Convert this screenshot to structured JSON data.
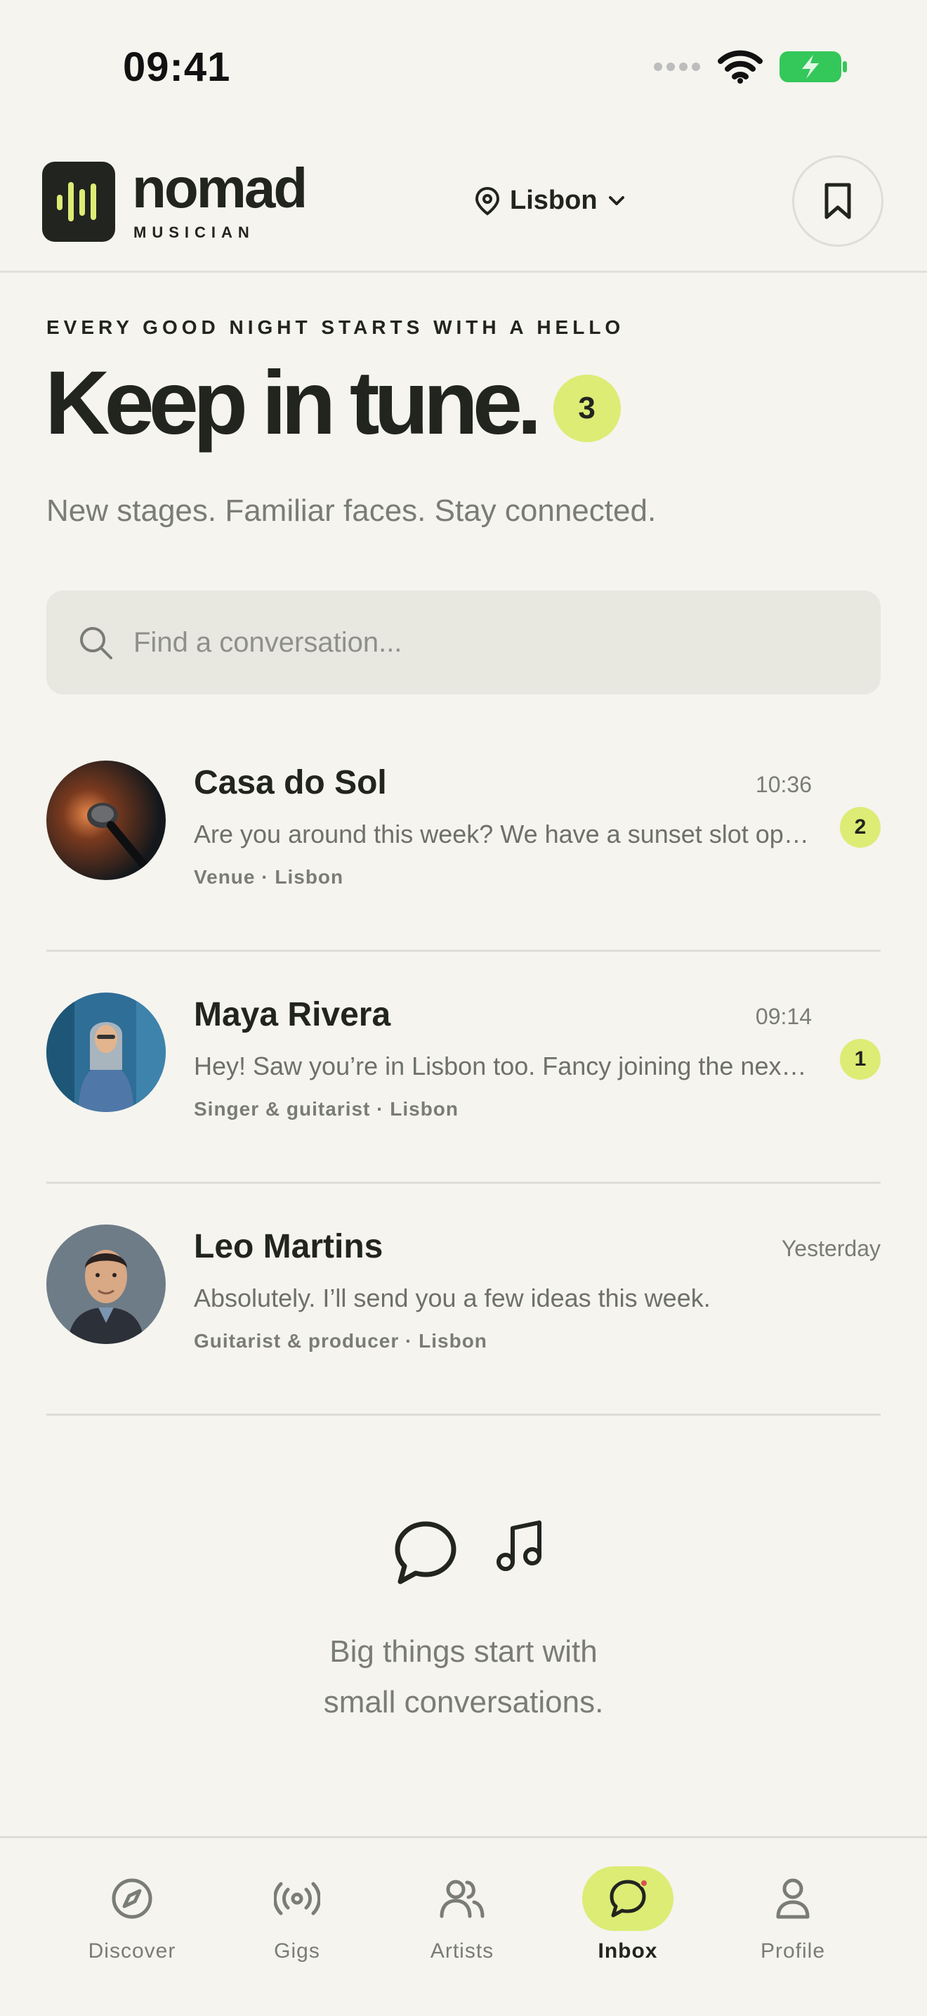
{
  "status_bar": {
    "time": "09:41"
  },
  "header": {
    "brand_name": "nomad",
    "brand_sub": "MUSICIAN",
    "location": "Lisbon"
  },
  "hero": {
    "eyebrow": "EVERY GOOD NIGHT STARTS WITH A HELLO",
    "headline": "Keep in tune.",
    "unread_count": "3",
    "subhead": "New stages. Familiar faces. Stay connected."
  },
  "search": {
    "placeholder": "Find a conversation..."
  },
  "conversations": [
    {
      "name": "Casa do Sol",
      "time": "10:36",
      "message": "Are you around this week? We have a sunset slot open...",
      "meta": "Venue · Lisbon",
      "unread": "2"
    },
    {
      "name": "Maya Rivera",
      "time": "09:14",
      "message": "Hey! Saw you’re in Lisbon too. Fancy joining the next j...",
      "meta": "Singer & guitarist · Lisbon",
      "unread": "1"
    },
    {
      "name": "Leo Martins",
      "time": "Yesterday",
      "message": "Absolutely. I’ll send you a few ideas this week.",
      "meta": "Guitarist & producer · Lisbon"
    }
  ],
  "empty_state": {
    "line1": "Big things start with",
    "line2": "small conversations."
  },
  "tabs": [
    {
      "label": "Discover",
      "icon": "compass-icon"
    },
    {
      "label": "Gigs",
      "icon": "broadcast-icon"
    },
    {
      "label": "Artists",
      "icon": "users-icon"
    },
    {
      "label": "Inbox",
      "icon": "chat-icon",
      "active": true
    },
    {
      "label": "Profile",
      "icon": "user-icon"
    }
  ],
  "colors": {
    "accent": "#DCEC75",
    "background": "#F5F4EF",
    "ink": "#22241F",
    "muted": "#7A7C76",
    "notification_dot": "#D8534F",
    "battery": "#34C759"
  }
}
